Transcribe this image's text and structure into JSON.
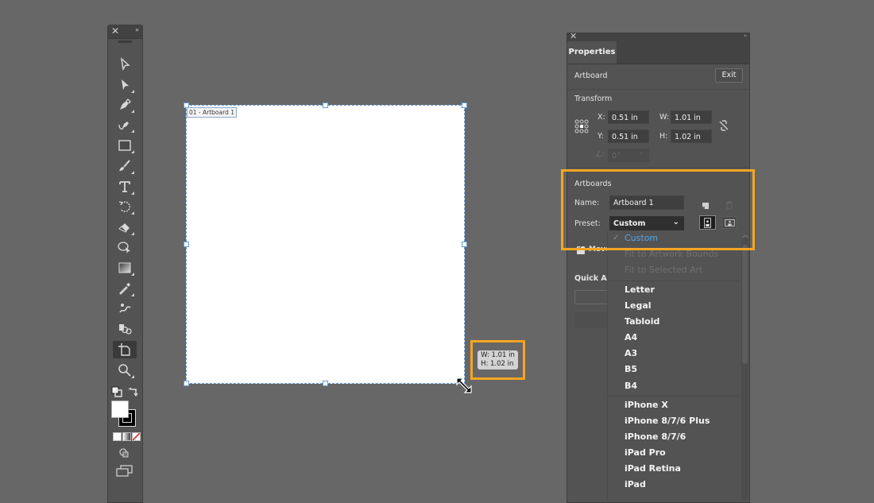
{
  "toolbar": {
    "close_glyph": "✕",
    "collapse_glyph": "»",
    "tools": [
      {
        "name": "selection-tool"
      },
      {
        "name": "direct-selection-tool"
      },
      {
        "name": "pen-tool"
      },
      {
        "name": "curvature-tool"
      },
      {
        "name": "rectangle-tool"
      },
      {
        "name": "paintbrush-tool"
      },
      {
        "name": "type-tool"
      },
      {
        "name": "rotate-tool"
      },
      {
        "name": "eraser-tool"
      },
      {
        "name": "shape-builder-tool"
      },
      {
        "name": "gradient-tool"
      },
      {
        "name": "eyedropper-tool"
      },
      {
        "name": "puppet-warp-tool"
      },
      {
        "name": "symbol-sprayer-tool"
      },
      {
        "name": "artboard-tool",
        "active": true
      },
      {
        "name": "zoom-tool"
      }
    ],
    "fill_color": "#ffffff",
    "stroke_color": "#000000"
  },
  "canvas": {
    "artboard_label": "01 - Artboard 1",
    "size_tooltip": {
      "w": "W: 1.01 in",
      "h": "H: 1.02 in"
    },
    "selection_color": "#6b9bd6",
    "highlight_color": "#f5a623"
  },
  "panel": {
    "close_glyph": "✕",
    "collapse_glyph": "«",
    "tab": "Properties",
    "artboard_label": "Artboard",
    "exit_label": "Exit",
    "transform": {
      "title": "Transform",
      "x_label": "X:",
      "x_value": "0.51 in",
      "y_label": "Y:",
      "y_value": "0.51 in",
      "w_label": "W:",
      "w_value": "1.01 in",
      "h_label": "H:",
      "h_value": "1.02 in",
      "angle_value": "0°"
    },
    "artboards": {
      "title": "Artboards",
      "name_label": "Name:",
      "name_value": "Artboard 1",
      "preset_label": "Preset:",
      "preset_value": "Custom"
    },
    "move_label": "Move",
    "quick_actions_label": "Quick Act"
  },
  "preset_dropdown": {
    "check_glyph": "✓",
    "selected": "Custom",
    "disabled_items": [
      "Fit to Artwork Bounds",
      "Fit to Selected Art"
    ],
    "paper_items": [
      "Letter",
      "Legal",
      "Tabloid",
      "A4",
      "A3",
      "B5",
      "B4"
    ],
    "device_items": [
      "iPhone X",
      "iPhone 8/7/6 Plus",
      "iPhone 8/7/6",
      "iPad Pro",
      "iPad Retina",
      "iPad"
    ],
    "selected_color": "#4ea6ea"
  }
}
